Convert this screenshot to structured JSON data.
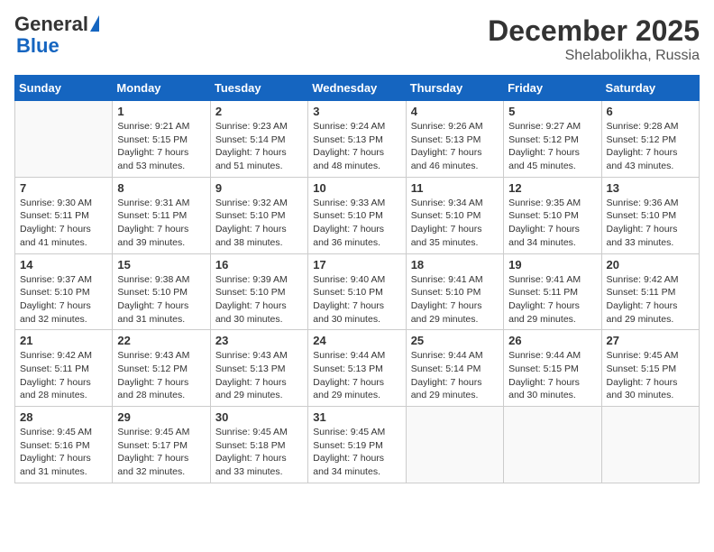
{
  "header": {
    "logo_general": "General",
    "logo_blue": "Blue",
    "month_year": "December 2025",
    "location": "Shelabolikha, Russia"
  },
  "days_of_week": [
    "Sunday",
    "Monday",
    "Tuesday",
    "Wednesday",
    "Thursday",
    "Friday",
    "Saturday"
  ],
  "weeks": [
    [
      {
        "day": "",
        "info": ""
      },
      {
        "day": "1",
        "info": "Sunrise: 9:21 AM\nSunset: 5:15 PM\nDaylight: 7 hours\nand 53 minutes."
      },
      {
        "day": "2",
        "info": "Sunrise: 9:23 AM\nSunset: 5:14 PM\nDaylight: 7 hours\nand 51 minutes."
      },
      {
        "day": "3",
        "info": "Sunrise: 9:24 AM\nSunset: 5:13 PM\nDaylight: 7 hours\nand 48 minutes."
      },
      {
        "day": "4",
        "info": "Sunrise: 9:26 AM\nSunset: 5:13 PM\nDaylight: 7 hours\nand 46 minutes."
      },
      {
        "day": "5",
        "info": "Sunrise: 9:27 AM\nSunset: 5:12 PM\nDaylight: 7 hours\nand 45 minutes."
      },
      {
        "day": "6",
        "info": "Sunrise: 9:28 AM\nSunset: 5:12 PM\nDaylight: 7 hours\nand 43 minutes."
      }
    ],
    [
      {
        "day": "7",
        "info": "Sunrise: 9:30 AM\nSunset: 5:11 PM\nDaylight: 7 hours\nand 41 minutes."
      },
      {
        "day": "8",
        "info": "Sunrise: 9:31 AM\nSunset: 5:11 PM\nDaylight: 7 hours\nand 39 minutes."
      },
      {
        "day": "9",
        "info": "Sunrise: 9:32 AM\nSunset: 5:10 PM\nDaylight: 7 hours\nand 38 minutes."
      },
      {
        "day": "10",
        "info": "Sunrise: 9:33 AM\nSunset: 5:10 PM\nDaylight: 7 hours\nand 36 minutes."
      },
      {
        "day": "11",
        "info": "Sunrise: 9:34 AM\nSunset: 5:10 PM\nDaylight: 7 hours\nand 35 minutes."
      },
      {
        "day": "12",
        "info": "Sunrise: 9:35 AM\nSunset: 5:10 PM\nDaylight: 7 hours\nand 34 minutes."
      },
      {
        "day": "13",
        "info": "Sunrise: 9:36 AM\nSunset: 5:10 PM\nDaylight: 7 hours\nand 33 minutes."
      }
    ],
    [
      {
        "day": "14",
        "info": "Sunrise: 9:37 AM\nSunset: 5:10 PM\nDaylight: 7 hours\nand 32 minutes."
      },
      {
        "day": "15",
        "info": "Sunrise: 9:38 AM\nSunset: 5:10 PM\nDaylight: 7 hours\nand 31 minutes."
      },
      {
        "day": "16",
        "info": "Sunrise: 9:39 AM\nSunset: 5:10 PM\nDaylight: 7 hours\nand 30 minutes."
      },
      {
        "day": "17",
        "info": "Sunrise: 9:40 AM\nSunset: 5:10 PM\nDaylight: 7 hours\nand 30 minutes."
      },
      {
        "day": "18",
        "info": "Sunrise: 9:41 AM\nSunset: 5:10 PM\nDaylight: 7 hours\nand 29 minutes."
      },
      {
        "day": "19",
        "info": "Sunrise: 9:41 AM\nSunset: 5:11 PM\nDaylight: 7 hours\nand 29 minutes."
      },
      {
        "day": "20",
        "info": "Sunrise: 9:42 AM\nSunset: 5:11 PM\nDaylight: 7 hours\nand 29 minutes."
      }
    ],
    [
      {
        "day": "21",
        "info": "Sunrise: 9:42 AM\nSunset: 5:11 PM\nDaylight: 7 hours\nand 28 minutes."
      },
      {
        "day": "22",
        "info": "Sunrise: 9:43 AM\nSunset: 5:12 PM\nDaylight: 7 hours\nand 28 minutes."
      },
      {
        "day": "23",
        "info": "Sunrise: 9:43 AM\nSunset: 5:13 PM\nDaylight: 7 hours\nand 29 minutes."
      },
      {
        "day": "24",
        "info": "Sunrise: 9:44 AM\nSunset: 5:13 PM\nDaylight: 7 hours\nand 29 minutes."
      },
      {
        "day": "25",
        "info": "Sunrise: 9:44 AM\nSunset: 5:14 PM\nDaylight: 7 hours\nand 29 minutes."
      },
      {
        "day": "26",
        "info": "Sunrise: 9:44 AM\nSunset: 5:15 PM\nDaylight: 7 hours\nand 30 minutes."
      },
      {
        "day": "27",
        "info": "Sunrise: 9:45 AM\nSunset: 5:15 PM\nDaylight: 7 hours\nand 30 minutes."
      }
    ],
    [
      {
        "day": "28",
        "info": "Sunrise: 9:45 AM\nSunset: 5:16 PM\nDaylight: 7 hours\nand 31 minutes."
      },
      {
        "day": "29",
        "info": "Sunrise: 9:45 AM\nSunset: 5:17 PM\nDaylight: 7 hours\nand 32 minutes."
      },
      {
        "day": "30",
        "info": "Sunrise: 9:45 AM\nSunset: 5:18 PM\nDaylight: 7 hours\nand 33 minutes."
      },
      {
        "day": "31",
        "info": "Sunrise: 9:45 AM\nSunset: 5:19 PM\nDaylight: 7 hours\nand 34 minutes."
      },
      {
        "day": "",
        "info": ""
      },
      {
        "day": "",
        "info": ""
      },
      {
        "day": "",
        "info": ""
      }
    ]
  ]
}
